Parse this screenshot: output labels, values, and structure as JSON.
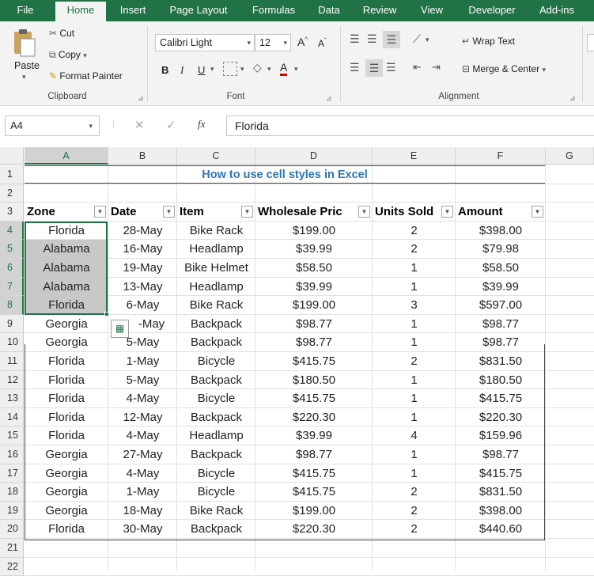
{
  "ribbon_tabs": [
    "File",
    "Home",
    "Insert",
    "Page Layout",
    "Formulas",
    "Data",
    "Review",
    "View",
    "Developer",
    "Add-ins"
  ],
  "active_tab": "Home",
  "clipboard": {
    "paste": "Paste",
    "cut": "Cut",
    "copy": "Copy",
    "format_painter": "Format Painter",
    "group": "Clipboard"
  },
  "font": {
    "name": "Calibri Light",
    "size": "12",
    "bold": "B",
    "italic": "I",
    "underline": "U",
    "grow": "A",
    "shrink": "A",
    "font_color": "A",
    "group": "Font"
  },
  "alignment": {
    "wrap_text": "Wrap Text",
    "merge_center": "Merge & Center",
    "group": "Alignment"
  },
  "formula_bar": {
    "name_box": "A4",
    "fx": "fx",
    "cancel": "✕",
    "enter": "✓",
    "content": "Florida"
  },
  "columns": [
    "A",
    "B",
    "C",
    "D",
    "E",
    "F",
    "G"
  ],
  "rows": [
    "1",
    "2",
    "3",
    "4",
    "5",
    "6",
    "7",
    "8",
    "9",
    "10",
    "11",
    "12",
    "13",
    "14",
    "15",
    "16",
    "17",
    "18",
    "19",
    "20",
    "21",
    "22"
  ],
  "title": "How to use cell styles in Excel",
  "table_headers": [
    "Zone",
    "Date",
    "Item",
    "Wholesale Pric",
    "Units Sold",
    "Amount"
  ],
  "table_rows": [
    [
      "Florida",
      "28-May",
      "Bike Rack",
      "$199.00",
      "2",
      "$398.00"
    ],
    [
      "Alabama",
      "16-May",
      "Headlamp",
      "$39.99",
      "2",
      "$79.98"
    ],
    [
      "Alabama",
      "19-May",
      "Bike Helmet",
      "$58.50",
      "1",
      "$58.50"
    ],
    [
      "Alabama",
      "13-May",
      "Headlamp",
      "$39.99",
      "1",
      "$39.99"
    ],
    [
      "Florida",
      "6-May",
      "Bike Rack",
      "$199.00",
      "3",
      "$597.00"
    ],
    [
      "Georgia",
      "-May",
      "Backpack",
      "$98.77",
      "1",
      "$98.77"
    ],
    [
      "Georgia",
      "5-May",
      "Backpack",
      "$98.77",
      "1",
      "$98.77"
    ],
    [
      "Florida",
      "1-May",
      "Bicycle",
      "$415.75",
      "2",
      "$831.50"
    ],
    [
      "Florida",
      "5-May",
      "Backpack",
      "$180.50",
      "1",
      "$180.50"
    ],
    [
      "Florida",
      "4-May",
      "Bicycle",
      "$415.75",
      "1",
      "$415.75"
    ],
    [
      "Florida",
      "12-May",
      "Backpack",
      "$220.30",
      "1",
      "$220.30"
    ],
    [
      "Florida",
      "4-May",
      "Headlamp",
      "$39.99",
      "4",
      "$159.96"
    ],
    [
      "Georgia",
      "27-May",
      "Backpack",
      "$98.77",
      "1",
      "$98.77"
    ],
    [
      "Georgia",
      "4-May",
      "Bicycle",
      "$415.75",
      "1",
      "$415.75"
    ],
    [
      "Georgia",
      "1-May",
      "Bicycle",
      "$415.75",
      "2",
      "$831.50"
    ],
    [
      "Georgia",
      "18-May",
      "Bike Rack",
      "$199.00",
      "2",
      "$398.00"
    ],
    [
      "Florida",
      "30-May",
      "Backpack",
      "$220.30",
      "2",
      "$440.60"
    ]
  ],
  "colors": {
    "excel_green": "#217346",
    "selection_fill": "#c8c8c8",
    "title_blue": "#2e75b6"
  }
}
